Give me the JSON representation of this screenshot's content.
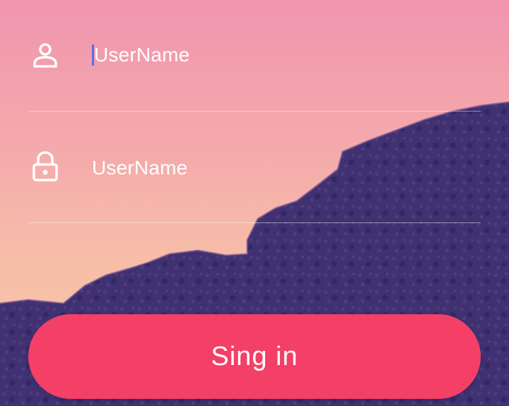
{
  "form": {
    "username_field": {
      "placeholder": "UserName",
      "icon": "person-icon",
      "focused": true
    },
    "password_field": {
      "placeholder": "UserName",
      "icon": "lock-icon"
    },
    "signin_button": {
      "label": "Sing in"
    }
  },
  "colors": {
    "accent": "#f43f66",
    "cursor": "#5c6cf0",
    "sky_top": "#f095ae",
    "sky_bottom": "#f7c6a6",
    "rock": "#3d2f6e"
  }
}
